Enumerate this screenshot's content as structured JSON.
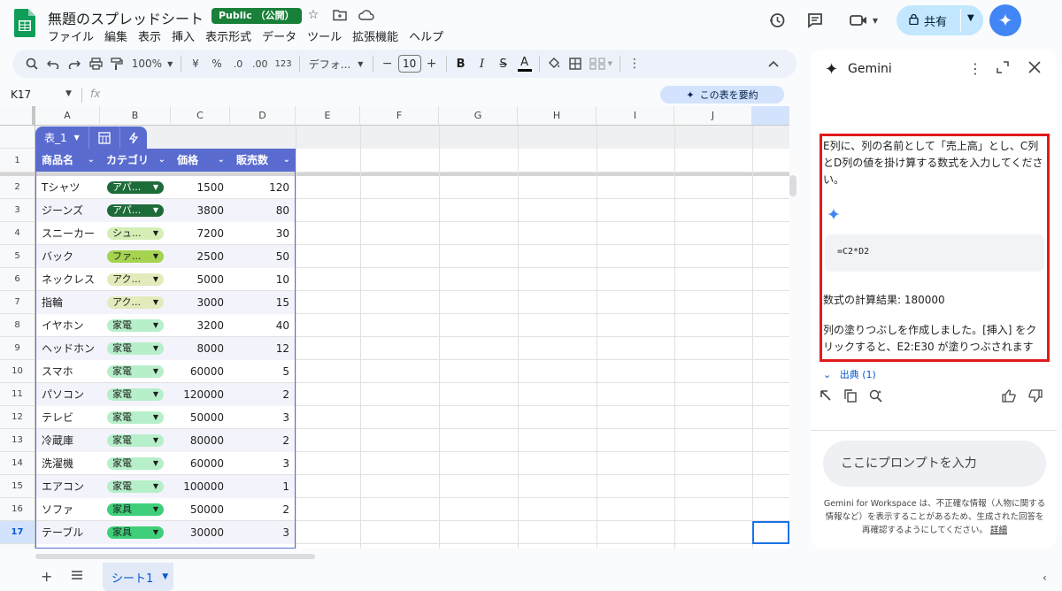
{
  "app": {
    "doc_title": "無題のスプレッドシート",
    "public_badge": "Public （公開）",
    "menu": [
      "ファイル",
      "編集",
      "表示",
      "挿入",
      "表示形式",
      "データ",
      "ツール",
      "拡張機能",
      "ヘルプ"
    ],
    "share_label": "共有"
  },
  "toolbar": {
    "zoom": "100%",
    "currency": "¥",
    "percent": "%",
    "dec_less": ".0",
    "dec_more": ".00",
    "num_format": "123",
    "font": "デフォ...",
    "font_size": "10",
    "minus": "−",
    "plus": "+",
    "bold": "B",
    "italic": "I",
    "strike": "S",
    "text_color_glyph": "A"
  },
  "formula_bar": {
    "name_box": "K17",
    "fx": "fx",
    "summarize_label": "この表を要約"
  },
  "columns": [
    "A",
    "B",
    "C",
    "D",
    "E",
    "F",
    "G",
    "H",
    "I",
    "J"
  ],
  "table": {
    "name": "表_1",
    "headers": [
      "商品名",
      "カテゴリ",
      "価格",
      "販売数"
    ],
    "rows": [
      {
        "name": "Tシャツ",
        "cat": "アパ...",
        "price": "1500",
        "qty": "120",
        "catColor": "#1e6b3a",
        "catText": "#ffffff"
      },
      {
        "name": "ジーンズ",
        "cat": "アパ...",
        "price": "3800",
        "qty": "80",
        "catColor": "#1e6b3a",
        "catText": "#ffffff"
      },
      {
        "name": "スニーカー",
        "cat": "シュ...",
        "price": "7200",
        "qty": "30",
        "catColor": "#d4eeb6",
        "catText": "#1f1f1f"
      },
      {
        "name": "バック",
        "cat": "ファ...",
        "price": "2500",
        "qty": "50",
        "catColor": "#a5d34f",
        "catText": "#1f1f1f"
      },
      {
        "name": "ネックレス",
        "cat": "アク...",
        "price": "5000",
        "qty": "10",
        "catColor": "#e3ebbc",
        "catText": "#1f1f1f"
      },
      {
        "name": "指輪",
        "cat": "アク...",
        "price": "3000",
        "qty": "15",
        "catColor": "#e3ebbc",
        "catText": "#1f1f1f"
      },
      {
        "name": "イヤホン",
        "cat": "家電",
        "price": "3200",
        "qty": "40",
        "catColor": "#b6efc9",
        "catText": "#1f1f1f"
      },
      {
        "name": "ヘッドホン",
        "cat": "家電",
        "price": "8000",
        "qty": "12",
        "catColor": "#b6efc9",
        "catText": "#1f1f1f"
      },
      {
        "name": "スマホ",
        "cat": "家電",
        "price": "60000",
        "qty": "5",
        "catColor": "#b6efc9",
        "catText": "#1f1f1f"
      },
      {
        "name": "パソコン",
        "cat": "家電",
        "price": "120000",
        "qty": "2",
        "catColor": "#b6efc9",
        "catText": "#1f1f1f"
      },
      {
        "name": "テレビ",
        "cat": "家電",
        "price": "50000",
        "qty": "3",
        "catColor": "#b6efc9",
        "catText": "#1f1f1f"
      },
      {
        "name": "冷蔵庫",
        "cat": "家電",
        "price": "80000",
        "qty": "2",
        "catColor": "#b6efc9",
        "catText": "#1f1f1f"
      },
      {
        "name": "洗濯機",
        "cat": "家電",
        "price": "60000",
        "qty": "3",
        "catColor": "#b6efc9",
        "catText": "#1f1f1f"
      },
      {
        "name": "エアコン",
        "cat": "家電",
        "price": "100000",
        "qty": "1",
        "catColor": "#b6efc9",
        "catText": "#1f1f1f"
      },
      {
        "name": "ソファ",
        "cat": "家具",
        "price": "50000",
        "qty": "2",
        "catColor": "#3fcf7a",
        "catText": "#1f1f1f"
      },
      {
        "name": "テーブル",
        "cat": "家具",
        "price": "30000",
        "qty": "3",
        "catColor": "#3fcf7a",
        "catText": "#1f1f1f"
      }
    ]
  },
  "gemini": {
    "title": "Gemini",
    "prompt_text": "E列に、列の名前として「売上高」とし、C列とD列の値を掛け算する数式を入力してください。",
    "formula": "=C2*D2",
    "result": "数式の計算結果: 180000",
    "fill_note": "列の塗りつぶしを作成しました。[挿入] をクリックすると、E2:E30 が塗りつぶされます",
    "sources": "出典 (1)",
    "input_placeholder": "ここにプロンプトを入力",
    "disclaimer": "Gemini for Workspace は、不正確な情報（人物に関する情報など）を表示することがあるため、生成された回答を再確認するようにしてください。",
    "disclaimer_link": "詳細"
  },
  "sheets": {
    "active_tab": "シート1"
  },
  "colors": {
    "accent": "#1a73e8",
    "table_header": "#5a6bd0",
    "highlight_border": "#e01a1a"
  }
}
